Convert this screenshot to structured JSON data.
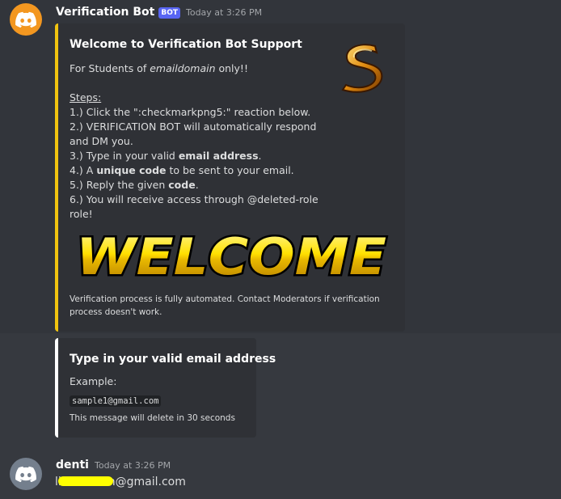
{
  "bot_message": {
    "username": "Verification Bot",
    "tag": "BOT",
    "timestamp": "Today at 3:26 PM",
    "avatar_icon": "discord-logo-icon",
    "accent_color": "#f1c40f",
    "embed": {
      "title": "Welcome to Verification Bot Support",
      "intro_prefix": "For Students of ",
      "intro_domain": "emaildomain",
      "intro_suffix": " only!!",
      "steps_heading": "Steps:",
      "step1": "1.) Click the \":checkmarkpng5:\" reaction below.",
      "step2a": "2.) VERIFICATION BOT will automatically respond",
      "step2b": "and DM you.",
      "step3_prefix": "3.) Type in your valid ",
      "step3_bold": "email address",
      "step3_suffix": ".",
      "step4_prefix": "4.) A ",
      "step4_bold": "unique code",
      "step4_suffix": " to be sent to your email.",
      "step5_prefix": "5.) Reply the given ",
      "step5_bold": "code",
      "step5_suffix": ".",
      "step6a": "6.) You will receive access through @deleted-role",
      "step6b": "role!",
      "image_text": "WELCOME",
      "footer_line1": "Verification process is fully automated. Contact Moderators if verification",
      "footer_line2": "process doesn't work."
    },
    "embed2": {
      "title": "Type in your valid email address",
      "example_label": "Example:",
      "example_code": "sample1@gmail.com",
      "footer": "This message will delete in 30 seconds"
    }
  },
  "user_message": {
    "username": "denti",
    "timestamp": "Today at 3:26 PM",
    "avatar_icon": "discord-logo-icon",
    "content_prefix": "li",
    "content_suffix": "n@gmail.com"
  }
}
